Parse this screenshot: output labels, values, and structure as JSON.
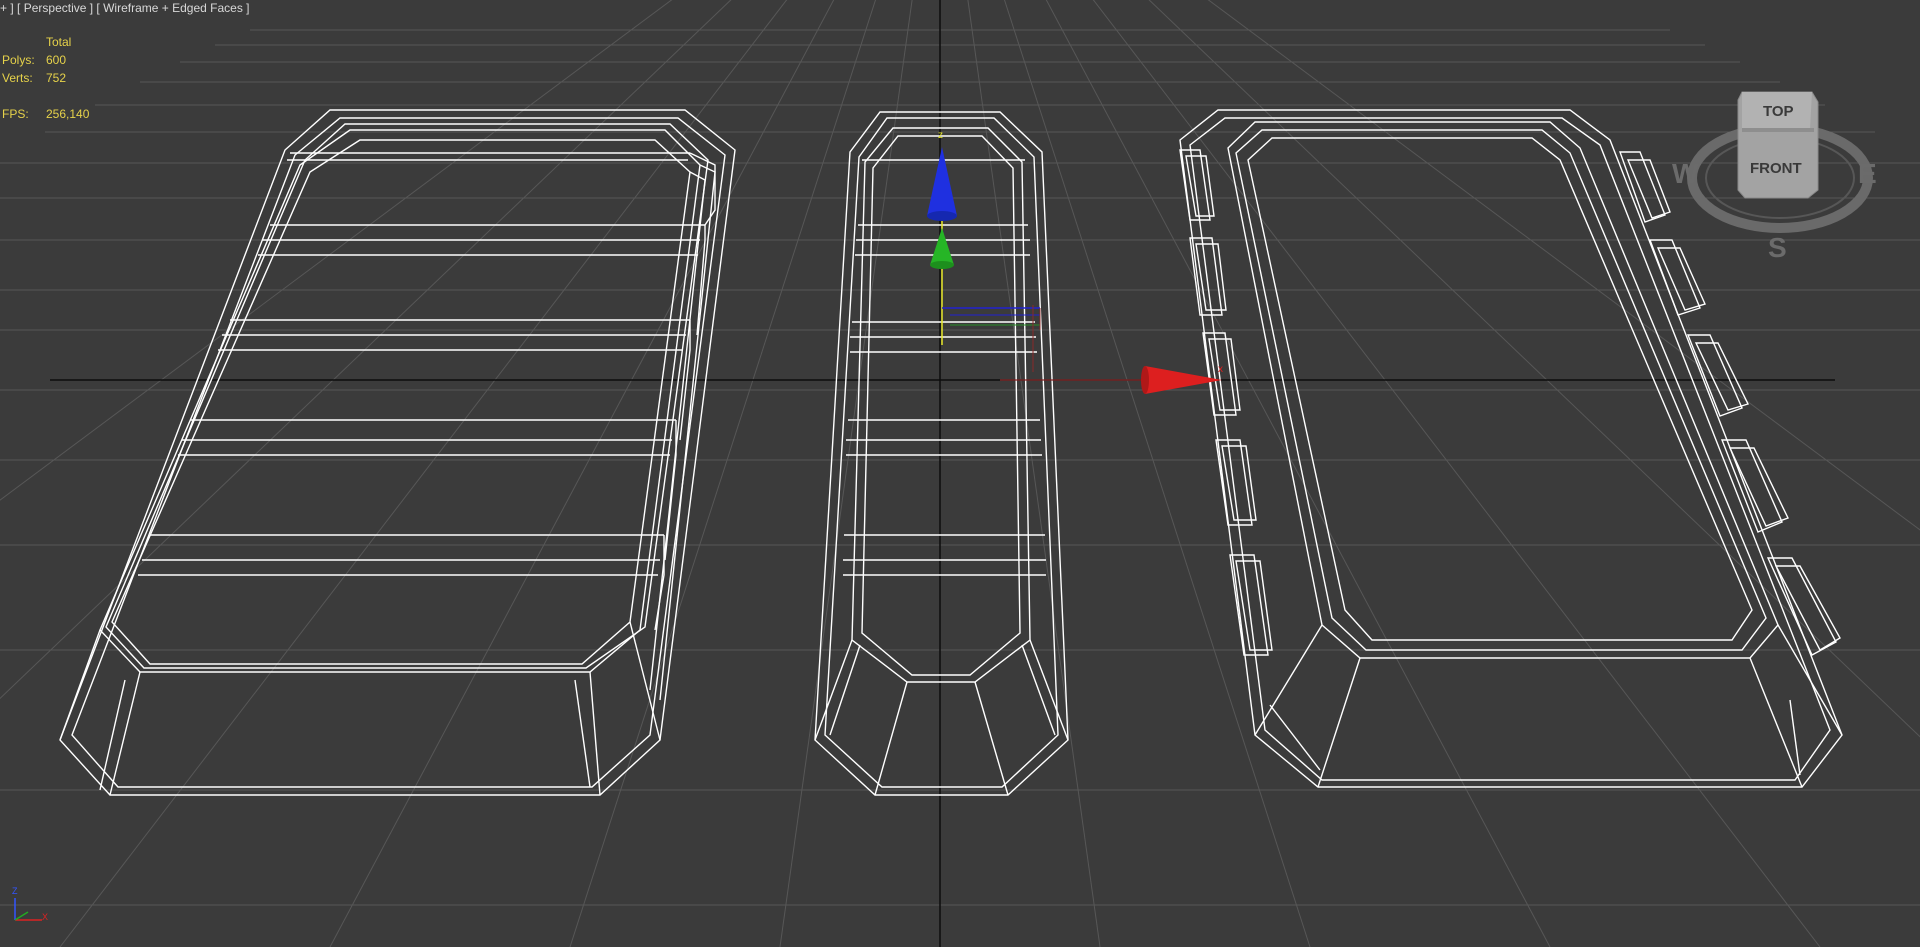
{
  "viewport": {
    "menu": {
      "plus": "+",
      "bracket_close": "]",
      "view_label": "[ Perspective ]",
      "shading_label": "[ Wireframe + Edged Faces ]"
    },
    "stats": {
      "header": "Total",
      "polys_label": "Polys:",
      "polys_value": "600",
      "verts_label": "Verts:",
      "verts_value": "752",
      "fps_label": "FPS:",
      "fps_value": "256,140"
    },
    "viewcube": {
      "top_label": "TOP",
      "front_label": "FRONT",
      "compass_w": "W",
      "compass_e": "E",
      "compass_s": "S"
    },
    "gizmo": {
      "z_label": "z",
      "x_label": "x"
    },
    "axis_tripod": {
      "z_label": "Z",
      "x_label": "X"
    }
  },
  "colors": {
    "background": "#3b3b3b",
    "grid": "#5a5a5a",
    "axis": "#0c0c0c",
    "wire": "#ffffff",
    "stats_text": "#e6d24a",
    "gizmo_x": "#dd1f1f",
    "gizmo_y": "#26b526",
    "gizmo_z": "#1f30e0"
  }
}
